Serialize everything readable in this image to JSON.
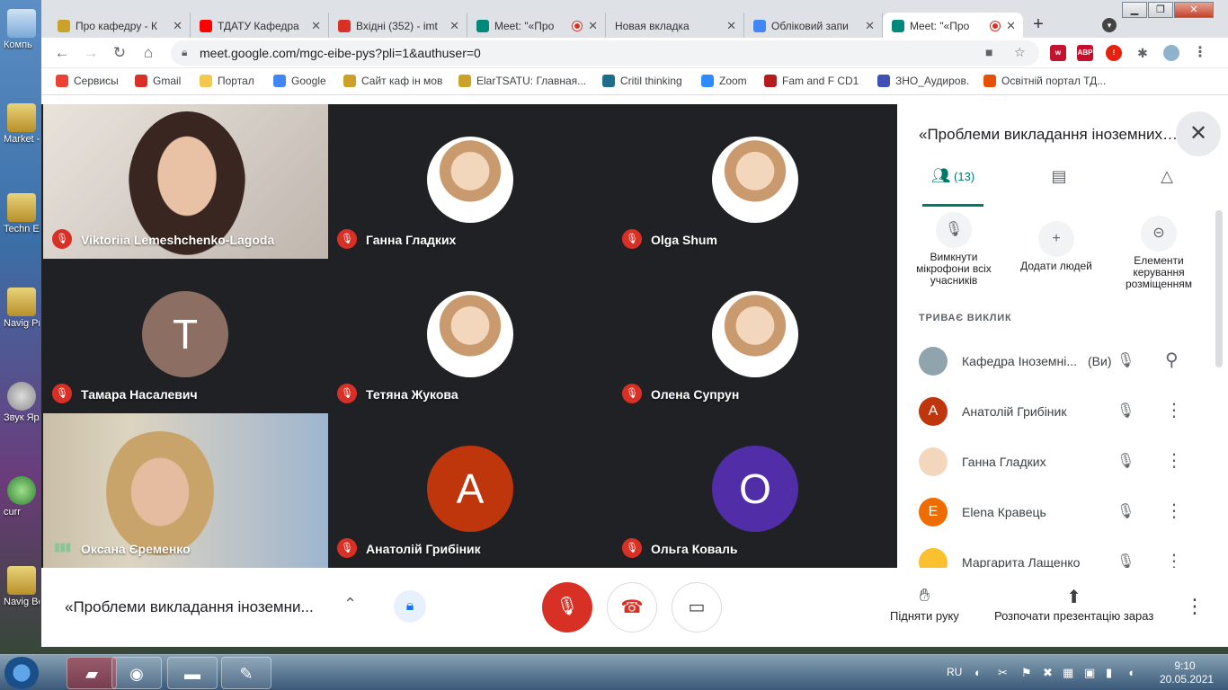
{
  "desktop": {
    "icons": [
      "Компь",
      "Market - Ярл",
      "Techn Engl",
      "Navig Pre-Inte",
      "Звук Ярл",
      "curr",
      "Navig Begin"
    ]
  },
  "browser": {
    "tabs": [
      {
        "label": "Про кафедру - К",
        "icon": "university-icon",
        "color": "#c9a227"
      },
      {
        "label": "ТДАТУ Кафедра",
        "icon": "youtube-icon",
        "color": "#ff0000"
      },
      {
        "label": "Вхідні (352) - imt",
        "icon": "gmail-icon",
        "color": "#d93025"
      },
      {
        "label": "Meet: \"«Про",
        "icon": "meet-icon",
        "color": "#00897b",
        "recording": true
      },
      {
        "label": "Новая вкладка",
        "icon": "",
        "color": ""
      },
      {
        "label": "Обліковий запи",
        "icon": "google-icon",
        "color": "#4285f4"
      },
      {
        "label": "Meet: \"«Про",
        "icon": "meet-icon",
        "color": "#00897b",
        "recording": true,
        "active": true
      }
    ],
    "new_tab": "+",
    "url": "meet.google.com/mgc-eibe-pys?pli=1&authuser=0",
    "extensions": [
      {
        "label": "ABP",
        "color": "#c70d2c"
      },
      {
        "label": "!",
        "color": "#e8210f"
      }
    ],
    "bookmarks": [
      {
        "label": "Сервисы",
        "color": "#ea4335"
      },
      {
        "label": "Gmail",
        "color": "#d93025"
      },
      {
        "label": "Портал",
        "color": "#f2c94c"
      },
      {
        "label": "Google",
        "color": "#4285f4"
      },
      {
        "label": "Сайт каф ін мов",
        "color": "#c9a227"
      },
      {
        "label": "ElarTSATU: Главная...",
        "color": "#c9a227"
      },
      {
        "label": "Critil thinking",
        "color": "#1c6e8c"
      },
      {
        "label": "Zoom",
        "color": "#2d8cff"
      },
      {
        "label": "Fam and F CD1",
        "color": "#b71c1c"
      },
      {
        "label": "ЗНО_Аудиров.",
        "color": "#3f51b5"
      },
      {
        "label": "Освітній портал ТД...",
        "color": "#e65100"
      }
    ]
  },
  "meet": {
    "tiles": [
      {
        "name": "Viktoriia Lemeshchenko-Lagoda",
        "kind": "video-1",
        "muted": true
      },
      {
        "name": "Ганна Гладких",
        "kind": "photo",
        "muted": true
      },
      {
        "name": "Olga Shum",
        "kind": "photo",
        "muted": true
      },
      {
        "name": "Тамара Насалевич",
        "kind": "letter",
        "letter": "T",
        "color": "#8d6e63",
        "muted": true
      },
      {
        "name": "Тетяна Жукова",
        "kind": "photo",
        "muted": true
      },
      {
        "name": "Олена Супрун",
        "kind": "photo",
        "muted": true
      },
      {
        "name": "Оксана Єременко",
        "kind": "video-2",
        "muted": false
      },
      {
        "name": "Анатолій Грибіник",
        "kind": "letter",
        "letter": "A",
        "color": "#c0360c",
        "muted": true
      },
      {
        "name": "Ольга Коваль",
        "kind": "letter",
        "letter": "O",
        "color": "#512da8",
        "muted": true
      }
    ],
    "panel": {
      "title": "«Проблеми викладання іноземних мов»",
      "people_count": "(13)",
      "actions": [
        {
          "label": "Вимкнути мікрофони всіх учасників",
          "icon": "mic-off-icon"
        },
        {
          "label": "Додати людей",
          "icon": "add-person-icon"
        },
        {
          "label": "Елементи керування розміщенням",
          "icon": "toggle-icon"
        }
      ],
      "section": "ТРИВАЄ ВИКЛИК",
      "people": [
        {
          "name": "Кафедра Іноземні...",
          "suffix": "(Ви)",
          "letter": "",
          "color": "#90a4ae",
          "more": "pin"
        },
        {
          "name": "Анатолій Грибіник",
          "suffix": "",
          "letter": "A",
          "color": "#c0360c",
          "more": "dots"
        },
        {
          "name": "Ганна Гладких",
          "suffix": "",
          "letter": "",
          "color": "#f3d7bd",
          "more": "dots"
        },
        {
          "name": "Elena Кравець",
          "suffix": "",
          "letter": "E",
          "color": "#ef6c00",
          "more": "dots"
        },
        {
          "name": "Маргарита Лащенко",
          "suffix": "",
          "letter": "",
          "color": "#fbc02d",
          "more": "dots"
        }
      ]
    },
    "bottom": {
      "meeting_title": "«Проблеми викладання іноземни...",
      "raise_hand": "Підняти руку",
      "present": "Розпочати презентацію зараз"
    }
  },
  "taskbar": {
    "lang": "RU",
    "time": "9:10",
    "date": "20.05.2021"
  }
}
